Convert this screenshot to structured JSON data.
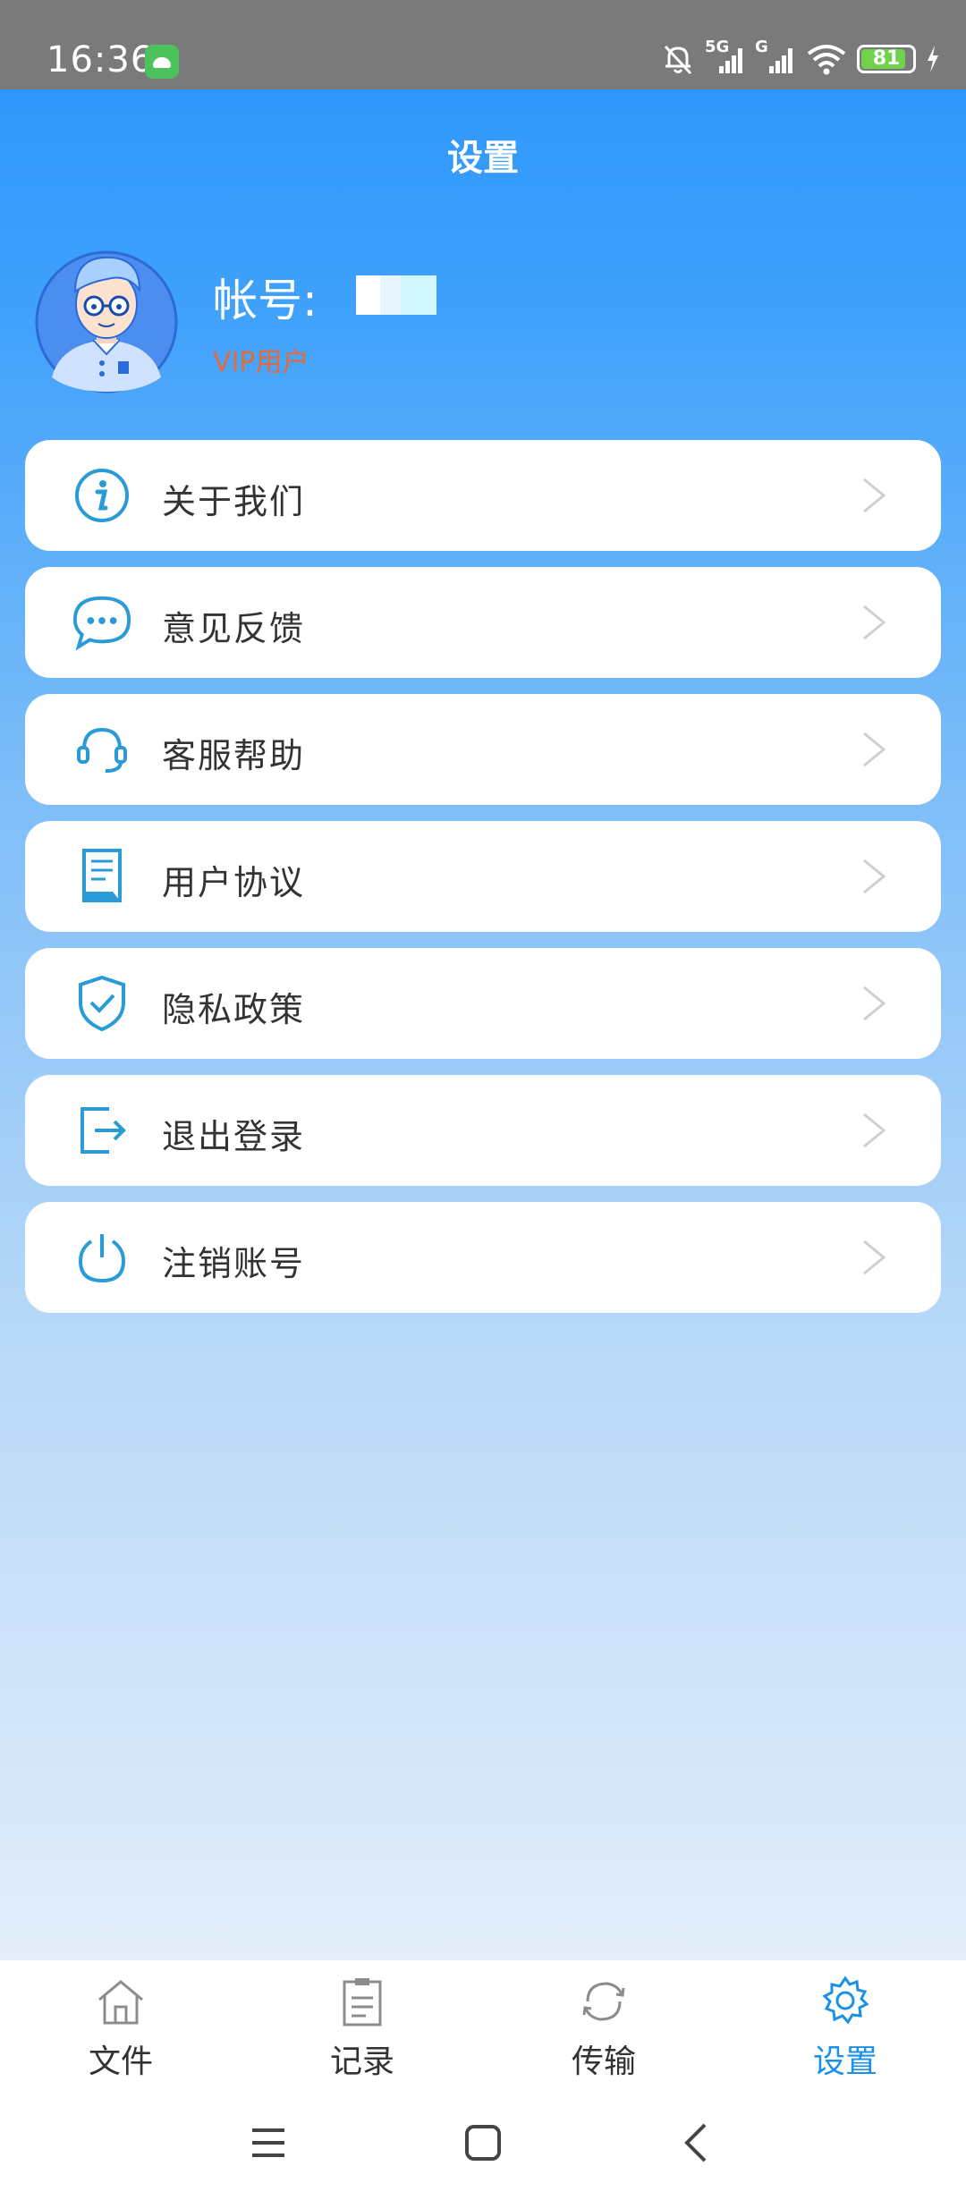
{
  "status_bar": {
    "time": "16:36",
    "network_1": "5G",
    "network_2": "G",
    "battery": "81",
    "icons": [
      "android-app-icon",
      "mute-bell-icon",
      "signal-icon",
      "wifi-icon",
      "battery-icon",
      "charging-icon"
    ]
  },
  "header": {
    "title": "设置"
  },
  "profile": {
    "account_label": "帐号:",
    "account_value_hidden": true,
    "vip_label": "VIP用户"
  },
  "menu": [
    {
      "label": "关于我们",
      "icon": "info-icon"
    },
    {
      "label": "意见反馈",
      "icon": "chat-bubble-icon"
    },
    {
      "label": "客服帮助",
      "icon": "headset-icon"
    },
    {
      "label": "用户协议",
      "icon": "document-icon"
    },
    {
      "label": "隐私政策",
      "icon": "shield-check-icon"
    },
    {
      "label": "退出登录",
      "icon": "logout-icon"
    },
    {
      "label": "注销账号",
      "icon": "power-icon"
    }
  ],
  "tabbar": {
    "tabs": [
      {
        "label": "文件",
        "icon": "home-icon",
        "active": false
      },
      {
        "label": "记录",
        "icon": "clipboard-icon",
        "active": false
      },
      {
        "label": "传输",
        "icon": "sync-icon",
        "active": false
      },
      {
        "label": "设置",
        "icon": "gear-icon",
        "active": true
      }
    ]
  },
  "colors": {
    "accent": "#1a90e6",
    "icon": "#2a9bd6",
    "vip": "#e46a3a",
    "header_bg": "#2a94fb"
  }
}
